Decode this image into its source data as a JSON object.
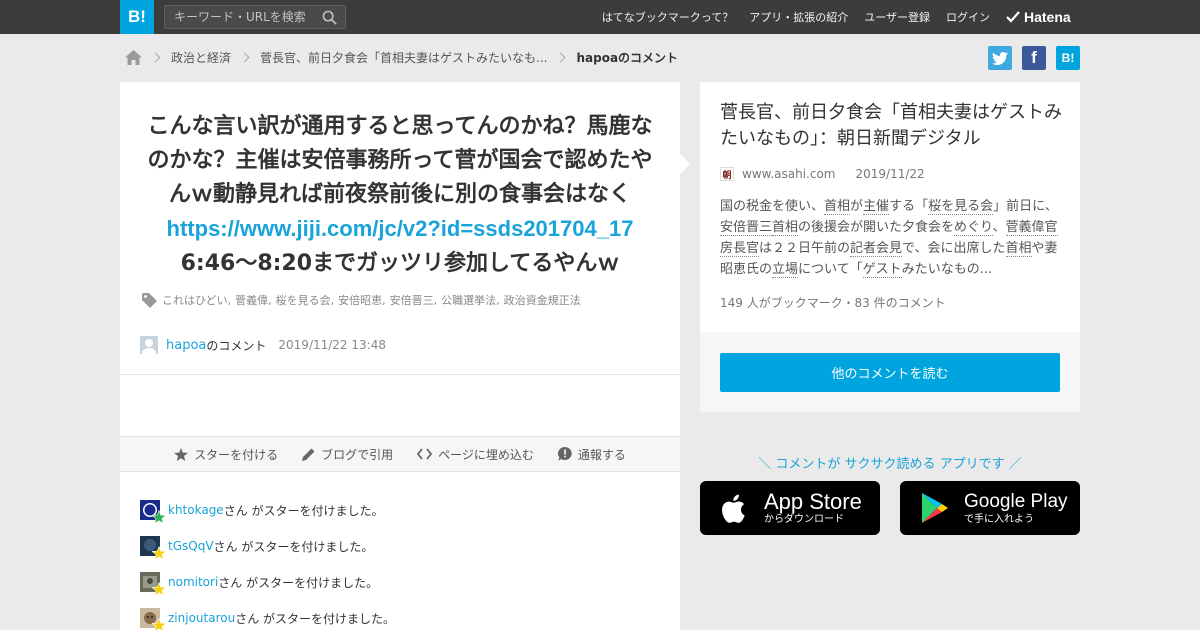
{
  "topbar": {
    "logo": "B!",
    "search_placeholder": "キーワード・URLを検索",
    "nav": [
      "はてなブックマークって？",
      "アプリ・拡張の紹介",
      "ユーザー登録",
      "ログイン"
    ],
    "hatena": "Hatena"
  },
  "breadcrumb": {
    "items": [
      "政治と経済",
      "菅長官、前日夕食会「首相夫妻はゲストみたいなも...",
      "hapoaのコメント"
    ]
  },
  "share": {
    "twitter": "t",
    "facebook": "f",
    "hatebu": "B!"
  },
  "comment": {
    "text_before": "こんな言い訳が通用すると思ってんのかね？馬鹿なのかな？主催は安倍事務所って菅が国会で認めたやんｗ動静見れば前夜祭前後に別の食事会はなく",
    "url": "https://www.jiji.com/jc/v2?id=ssds201704_17",
    "text_after": "6:46～8:20までガッツリ参加してるやんｗ",
    "tags": [
      "これはひどい",
      "菅義偉",
      "桜を見る会",
      "安倍昭恵",
      "安倍晋三",
      "公職選挙法",
      "政治資金規正法"
    ],
    "user": "hapoa",
    "user_suffix": "のコメント",
    "date": "2019/11/22 13:48"
  },
  "actions": [
    "スターを付ける",
    "ブログで引用",
    "ページに埋め込む",
    "通報する"
  ],
  "stars": [
    {
      "user": "khtokage",
      "suffix": "さん がスターを付けました。",
      "star_color": "#2bb24c"
    },
    {
      "user": "tGsQqV",
      "suffix": "さん がスターを付けました。",
      "star_color": "#f5d20c"
    },
    {
      "user": "nomitori",
      "suffix": "さん がスターを付けました。",
      "star_color": "#f5d20c"
    },
    {
      "user": "zinjoutarou",
      "suffix": "さん がスターを付けました。",
      "star_color": "#f5d20c"
    }
  ],
  "entry": {
    "title": "菅長官、前日夕食会「首相夫妻はゲストみたいなもの」：朝日新聞デジタル",
    "favicon": "朝",
    "domain": "www.asahi.com",
    "date": "2019/11/22",
    "summary": [
      {
        "t": "国の税金を使い、",
        "k": false
      },
      {
        "t": "首相",
        "k": true
      },
      {
        "t": "が",
        "k": false
      },
      {
        "t": "主催",
        "k": true
      },
      {
        "t": "する「",
        "k": false
      },
      {
        "t": "桜を見る会",
        "k": true
      },
      {
        "t": "」前日に、",
        "k": false
      },
      {
        "t": "安倍晋三",
        "k": true
      },
      {
        "t": "首相",
        "k": true
      },
      {
        "t": "の後援会が開いた夕食会を",
        "k": false
      },
      {
        "t": "めぐり",
        "k": true
      },
      {
        "t": "、",
        "k": false
      },
      {
        "t": "菅義偉官房長官",
        "k": true
      },
      {
        "t": "は２２日午前の",
        "k": false
      },
      {
        "t": "記者会見",
        "k": true
      },
      {
        "t": "で、会に出席した",
        "k": false
      },
      {
        "t": "首相",
        "k": true
      },
      {
        "t": "や妻",
        "k": false
      },
      {
        "t": "昭恵氏",
        "k": false
      },
      {
        "t": "の",
        "k": false
      },
      {
        "t": "立場",
        "k": true
      },
      {
        "t": "について「",
        "k": false
      },
      {
        "t": "ゲスト",
        "k": true
      },
      {
        "t": "みたいなもの...",
        "k": false
      }
    ],
    "counts": "149 人がブックマーク・83 件のコメント",
    "more_button": "他のコメントを読む"
  },
  "promo": "＼ コメントが サクサク読める アプリです ／",
  "stores": {
    "apple": {
      "big": "App Store",
      "small": "からダウンロード"
    },
    "google": {
      "big": "Google Play",
      "small": "で手に入れよう"
    }
  },
  "colors": {
    "accent": "#00a4de",
    "link": "#1aa3d9",
    "topbar": "#3c3c3c"
  }
}
